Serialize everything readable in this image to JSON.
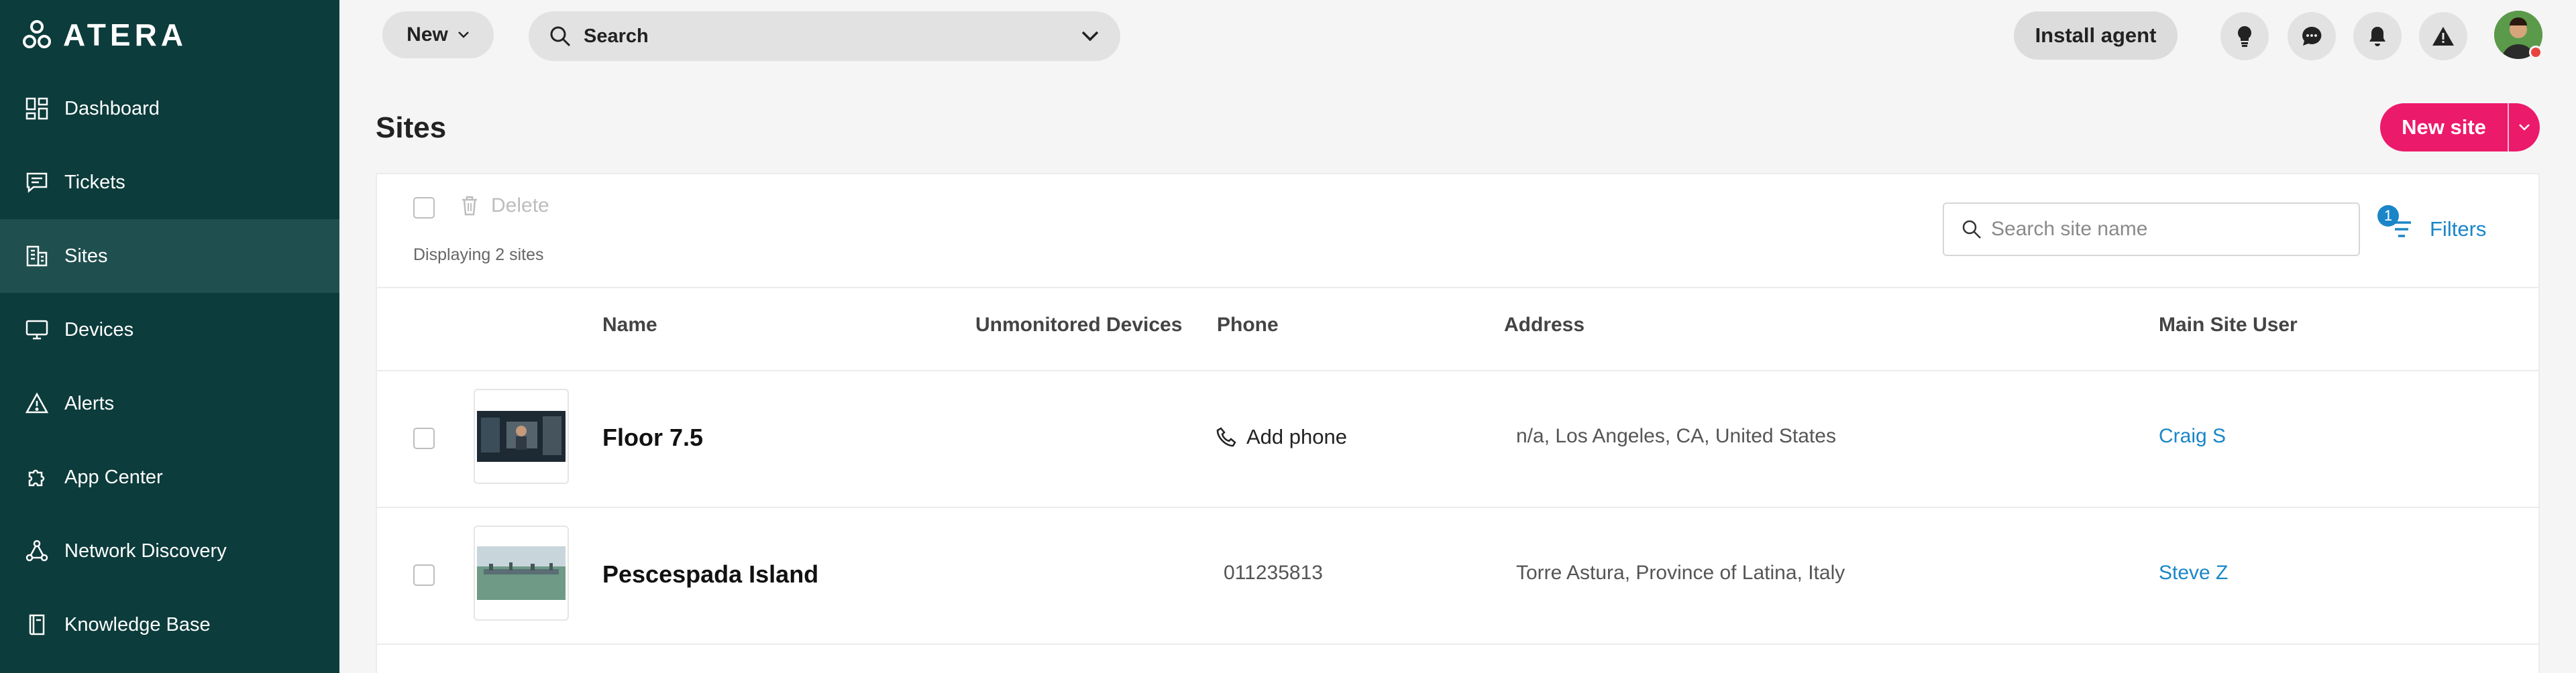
{
  "brand": {
    "logo_text": "ATERA"
  },
  "sidebar": {
    "items": [
      {
        "label": "Dashboard",
        "icon": "dashboard-icon",
        "active": false
      },
      {
        "label": "Tickets",
        "icon": "tickets-icon",
        "active": false
      },
      {
        "label": "Sites",
        "icon": "sites-icon",
        "active": true
      },
      {
        "label": "Devices",
        "icon": "devices-icon",
        "active": false
      },
      {
        "label": "Alerts",
        "icon": "alerts-icon",
        "active": false
      },
      {
        "label": "App Center",
        "icon": "app-center-icon",
        "active": false
      },
      {
        "label": "Network Discovery",
        "icon": "network-discovery-icon",
        "active": false
      },
      {
        "label": "Knowledge Base",
        "icon": "knowledge-base-icon",
        "active": false
      }
    ]
  },
  "topbar": {
    "new_label": "New",
    "search_label": "Search",
    "install_label": "Install agent",
    "icons": [
      "lightbulb-icon",
      "chat-icon",
      "bell-icon",
      "warning-icon"
    ]
  },
  "page": {
    "title": "Sites",
    "new_site_label": "New site"
  },
  "toolbar": {
    "delete_label": "Delete",
    "displaying": "Displaying 2 sites",
    "search_placeholder": "Search site name",
    "filters_label": "Filters",
    "filters_count": "1"
  },
  "table": {
    "columns": {
      "name": "Name",
      "unmonitored": "Unmonitored Devices",
      "phone": "Phone",
      "address": "Address",
      "main_user": "Main Site User"
    },
    "rows": [
      {
        "name": "Floor 7.5",
        "unmonitored": "",
        "phone": "Add phone",
        "phone_is_action": true,
        "address": "n/a, Los Angeles, CA, United States",
        "main_user": "Craig S"
      },
      {
        "name": "Pescespada Island",
        "unmonitored": "",
        "phone": "011235813",
        "phone_is_action": false,
        "address": "Torre Astura, Province of Latina, Italy",
        "main_user": "Steve Z"
      }
    ]
  },
  "colors": {
    "sidebar_bg": "#0c3c3b",
    "sidebar_active": "#1f4f4e",
    "accent_pink": "#ec1a6b",
    "link_blue": "#1a86c8"
  }
}
